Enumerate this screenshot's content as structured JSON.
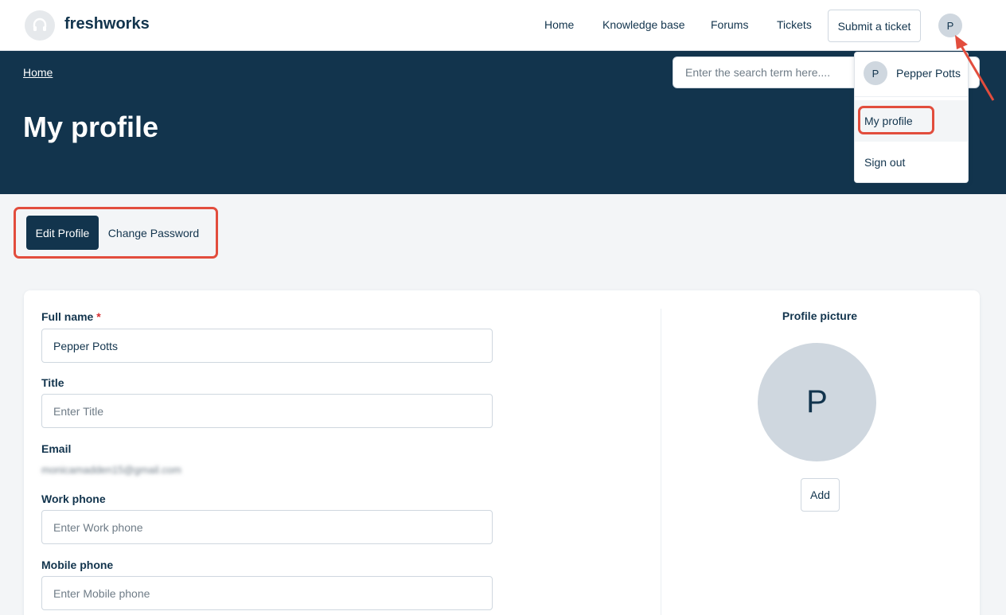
{
  "header": {
    "brand": "freshworks",
    "nav": [
      "Home",
      "Knowledge base",
      "Forums",
      "Tickets"
    ],
    "submit_ticket": "Submit a ticket",
    "avatar_initial": "P"
  },
  "hero": {
    "breadcrumb": "Home",
    "title": "My profile",
    "search_placeholder": "Enter the search term here...."
  },
  "user_menu": {
    "avatar_initial": "P",
    "user_name": "Pepper Potts",
    "items": [
      "My profile",
      "Sign out"
    ]
  },
  "tabs": {
    "active": "Edit Profile",
    "other": "Change Password"
  },
  "form": {
    "full_name_label": "Full name",
    "required_mark": "*",
    "full_name_value": "Pepper Potts",
    "title_label": "Title",
    "title_placeholder": "Enter Title",
    "email_label": "Email",
    "email_value": "monicamadden15@gmail.com",
    "work_phone_label": "Work phone",
    "work_phone_placeholder": "Enter Work phone",
    "mobile_phone_label": "Mobile phone",
    "mobile_phone_placeholder": "Enter Mobile phone"
  },
  "profile_picture": {
    "label": "Profile picture",
    "initial": "P",
    "add_label": "Add"
  },
  "colors": {
    "primary": "#12344d",
    "annotation": "#e24d3d",
    "avatar_bg": "#cfd7df"
  },
  "icons": {
    "logo": "headset-icon",
    "annotation_arrow": "arrow-annotation"
  }
}
